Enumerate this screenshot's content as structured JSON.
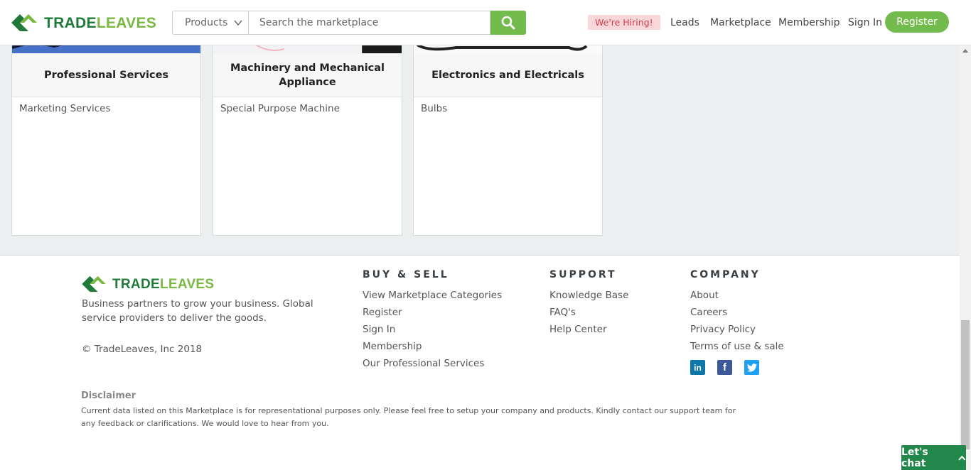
{
  "header": {
    "logo": {
      "part1": "TRADE",
      "part2": "LEAVES"
    },
    "search": {
      "category": "Products",
      "placeholder": "Search the marketplace"
    },
    "hiring_label": "We're Hiring!",
    "nav": [
      "Leads",
      "Marketplace",
      "Membership",
      "Sign In"
    ],
    "register_label": "Register"
  },
  "categories": [
    {
      "title": "Professional Services",
      "items": [
        "Marketing Services"
      ]
    },
    {
      "title": "Machinery and Mechanical Appliance",
      "items": [
        "Special Purpose Machine"
      ]
    },
    {
      "title": "Electronics and Electricals",
      "items": [
        "Bulbs"
      ]
    }
  ],
  "footer": {
    "logo": {
      "part1": "TRADE",
      "part2": "LEAVES"
    },
    "tagline": "Business partners to grow your business. Global service providers to deliver the goods.",
    "copyright": "© TradeLeaves, Inc 2018",
    "buy_sell": {
      "title": "BUY & SELL",
      "links": [
        "View Marketplace Categories",
        "Register",
        "Sign In",
        "Membership",
        "Our Professional Services"
      ]
    },
    "support": {
      "title": "SUPPORT",
      "links": [
        "Knowledge Base",
        "FAQ's",
        "Help Center"
      ]
    },
    "company": {
      "title": "COMPANY",
      "links": [
        "About",
        "Careers",
        "Privacy Policy",
        "Terms of use & sale"
      ],
      "social": [
        {
          "icon": "linkedin-icon",
          "glyph": "in",
          "color": "#0e76a8"
        },
        {
          "icon": "facebook-icon",
          "glyph": "f",
          "color": "#3b5998"
        },
        {
          "icon": "twitter-icon",
          "glyph": "t",
          "color": "#1da1f2"
        }
      ]
    },
    "disclaimer_title": "Disclaimer",
    "disclaimer_text": "Current data listed on this Marketplace is for representational purposes only. Please feel free to setup your company and products. Kindly contact our support team for any feedback or clarifications. We would love to hear from you."
  },
  "chat_label": "Let's chat",
  "colors": {
    "brand_dark": "#1f7a3a",
    "brand_light": "#79b843",
    "accent_green": "#72bb4c",
    "chat_green": "#21874a",
    "hiring_bg": "#f7d7da",
    "hiring_text": "#d23c4b"
  }
}
